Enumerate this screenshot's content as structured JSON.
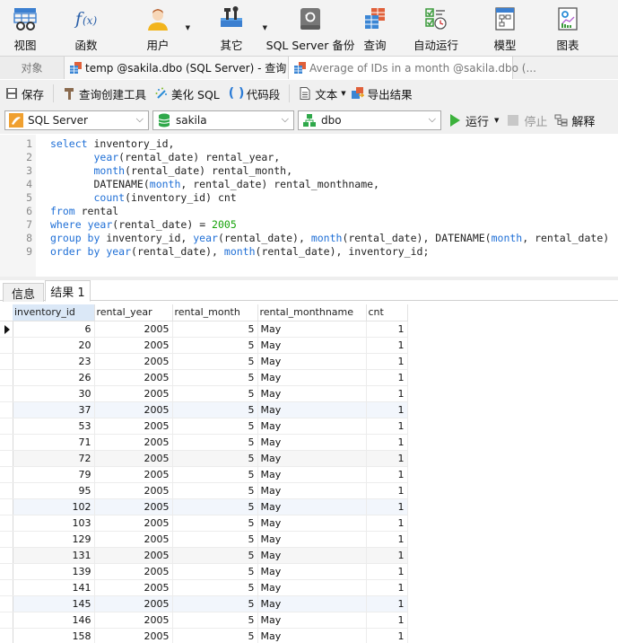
{
  "ribbon": {
    "items": [
      {
        "label": "视图",
        "icon": "view-icon",
        "has_dropdown": false
      },
      {
        "label": "函数",
        "icon": "function-icon",
        "has_dropdown": false
      },
      {
        "label": "用户",
        "icon": "user-icon",
        "has_dropdown": true
      },
      {
        "label": "其它",
        "icon": "tools-icon",
        "has_dropdown": true
      },
      {
        "label": "SQL Server 备份",
        "icon": "backup-icon",
        "has_dropdown": false
      },
      {
        "label": "查询",
        "icon": "query-icon",
        "has_dropdown": false
      },
      {
        "label": "自动运行",
        "icon": "automation-icon",
        "has_dropdown": false
      },
      {
        "label": "模型",
        "icon": "model-icon",
        "has_dropdown": false
      },
      {
        "label": "图表",
        "icon": "chart-icon",
        "has_dropdown": false
      }
    ]
  },
  "tabs": {
    "objects": "对象",
    "active": "temp @sakila.dbo (SQL Server) - 查询",
    "inactive": "Average of IDs in a month @sakila.dbo (..."
  },
  "toolbar": {
    "save": "保存",
    "query_builder": "查询创建工具",
    "beautify": "美化 SQL",
    "snippet": "代码段",
    "text": "文本",
    "export": "导出结果"
  },
  "selectors": {
    "connection": "SQL Server",
    "database": "sakila",
    "schema": "dbo",
    "run": "运行",
    "stop": "停止",
    "explain": "解释"
  },
  "editor": {
    "lines": [
      {
        "n": "1",
        "html": "<span class=\"kw\">select</span> inventory_id,"
      },
      {
        "n": "2",
        "html": "       <span class=\"kw\">year</span>(rental_date) rental_year,"
      },
      {
        "n": "3",
        "html": "       <span class=\"kw\">month</span>(rental_date) rental_month,"
      },
      {
        "n": "4",
        "html": "       DATENAME(<span class=\"kw\">month</span>, rental_date) rental_monthname,"
      },
      {
        "n": "5",
        "html": "       <span class=\"kw\">count</span>(inventory_id) cnt"
      },
      {
        "n": "6",
        "html": "<span class=\"kw\">from</span> rental"
      },
      {
        "n": "7",
        "html": "<span class=\"kw\">where</span> <span class=\"kw\">year</span>(rental_date) = <span class=\"num\">2005</span>"
      },
      {
        "n": "8",
        "html": "<span class=\"kw\">group by</span> inventory_id, <span class=\"kw\">year</span>(rental_date), <span class=\"kw\">month</span>(rental_date), DATENAME(<span class=\"kw\">month</span>, rental_date)"
      },
      {
        "n": "9",
        "html": "<span class=\"kw\">order by</span> <span class=\"kw\">year</span>(rental_date), <span class=\"kw\">month</span>(rental_date), inventory_id;"
      }
    ]
  },
  "result_tabs": {
    "info": "信息",
    "result1": "结果 1"
  },
  "grid": {
    "columns": [
      "inventory_id",
      "rental_year",
      "rental_month",
      "rental_monthname",
      "cnt"
    ],
    "rows": [
      [
        "6",
        "2005",
        "5",
        "May",
        "1"
      ],
      [
        "20",
        "2005",
        "5",
        "May",
        "1"
      ],
      [
        "23",
        "2005",
        "5",
        "May",
        "1"
      ],
      [
        "26",
        "2005",
        "5",
        "May",
        "1"
      ],
      [
        "30",
        "2005",
        "5",
        "May",
        "1"
      ],
      [
        "37",
        "2005",
        "5",
        "May",
        "1"
      ],
      [
        "53",
        "2005",
        "5",
        "May",
        "1"
      ],
      [
        "71",
        "2005",
        "5",
        "May",
        "1"
      ],
      [
        "72",
        "2005",
        "5",
        "May",
        "1"
      ],
      [
        "79",
        "2005",
        "5",
        "May",
        "1"
      ],
      [
        "95",
        "2005",
        "5",
        "May",
        "1"
      ],
      [
        "102",
        "2005",
        "5",
        "May",
        "1"
      ],
      [
        "103",
        "2005",
        "5",
        "May",
        "1"
      ],
      [
        "129",
        "2005",
        "5",
        "May",
        "1"
      ],
      [
        "131",
        "2005",
        "5",
        "May",
        "1"
      ],
      [
        "139",
        "2005",
        "5",
        "May",
        "1"
      ],
      [
        "141",
        "2005",
        "5",
        "May",
        "1"
      ],
      [
        "145",
        "2005",
        "5",
        "May",
        "1"
      ],
      [
        "146",
        "2005",
        "5",
        "May",
        "1"
      ],
      [
        "158",
        "2005",
        "5",
        "May",
        "1"
      ]
    ]
  }
}
